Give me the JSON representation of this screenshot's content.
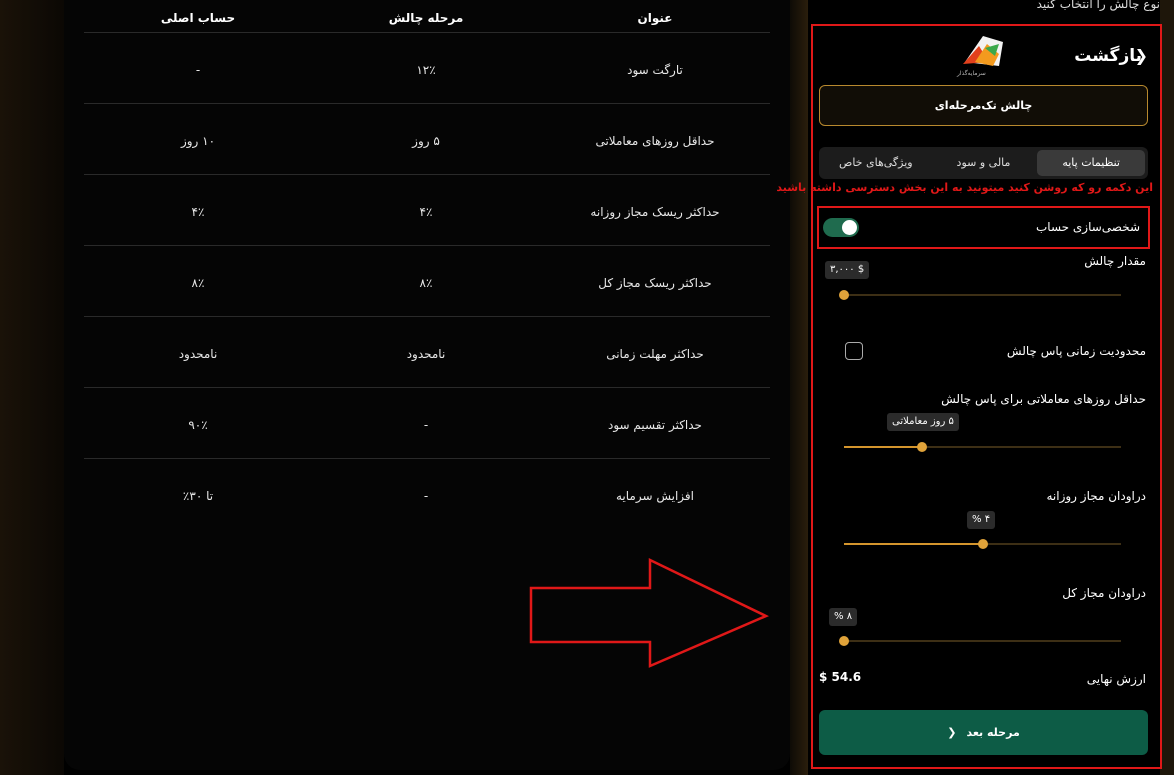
{
  "table": {
    "headers": {
      "title": "عنوان",
      "challenge_phase": "مرحله چالش",
      "main_account": "حساب اصلی"
    },
    "rows": [
      {
        "title": "تارگت سود",
        "challenge_phase": "۱۲٪",
        "main_account": "-"
      },
      {
        "title": "حداقل روزهای معاملاتی",
        "challenge_phase": "۵ روز",
        "main_account": "۱۰ روز"
      },
      {
        "title": "حداکثر ریسک مجاز روزانه",
        "challenge_phase": "۴٪",
        "main_account": "۴٪"
      },
      {
        "title": "حداکثر ریسک مجاز کل",
        "challenge_phase": "۸٪",
        "main_account": "۸٪"
      },
      {
        "title": "حداکثر مهلت زمانی",
        "challenge_phase": "نامحدود",
        "main_account": "نامحدود"
      },
      {
        "title": "حداکثر تقسیم سود",
        "challenge_phase": "-",
        "main_account": "۹۰٪"
      },
      {
        "title": "افزایش سرمایه",
        "challenge_phase": "-",
        "main_account": "تا ۳۰٪"
      }
    ]
  },
  "panel": {
    "top_title": "نوع چالش را انتخاب کنید",
    "back_label": "بازگشت",
    "back_icon": "chevron-right-icon",
    "logo_caption": "سرمایه‌گذار",
    "challenge_type": "چالش تک‌مرحله‌ای",
    "tabs": [
      {
        "label": "تنظیمات پایه",
        "active": true
      },
      {
        "label": "مالی و سود",
        "active": false
      },
      {
        "label": "ویژگی‌های خاص",
        "active": false
      }
    ],
    "annotation_note": "این دکمه رو که روشن کنید میتونید به این بخش دسترسی داشته باشید",
    "customize_label": "شخصی‌سازی حساب",
    "customize_on": true,
    "amount_label": "مقدار چالش",
    "amount_value": "$ ۳,۰۰۰",
    "amount_fraction": 0.0,
    "time_limit_label": "محدودیت زمانی پاس چالش",
    "time_limit_checked": false,
    "min_days_label": "حداقل روزهای معاملاتی برای پاس چالش",
    "min_days_value": "۵ روز معاملاتی",
    "min_days_fraction": 0.28,
    "daily_dd_label": "دراودان مجاز روزانه",
    "daily_dd_value": "۴ %",
    "daily_dd_fraction": 0.5,
    "total_dd_label": "دراودان مجاز کل",
    "total_dd_value": "۸ %",
    "total_dd_fraction": 0.0,
    "final_value_label": "ارزش نهایی",
    "final_value": "$ 54.6",
    "next_button": "مرحله بعد",
    "next_icon": "chevron-left-icon"
  },
  "colors": {
    "accent": "#d4952d",
    "annotation": "#e01818",
    "primary_button": "#0d5c46",
    "toggle_on": "#1f6b4e"
  }
}
